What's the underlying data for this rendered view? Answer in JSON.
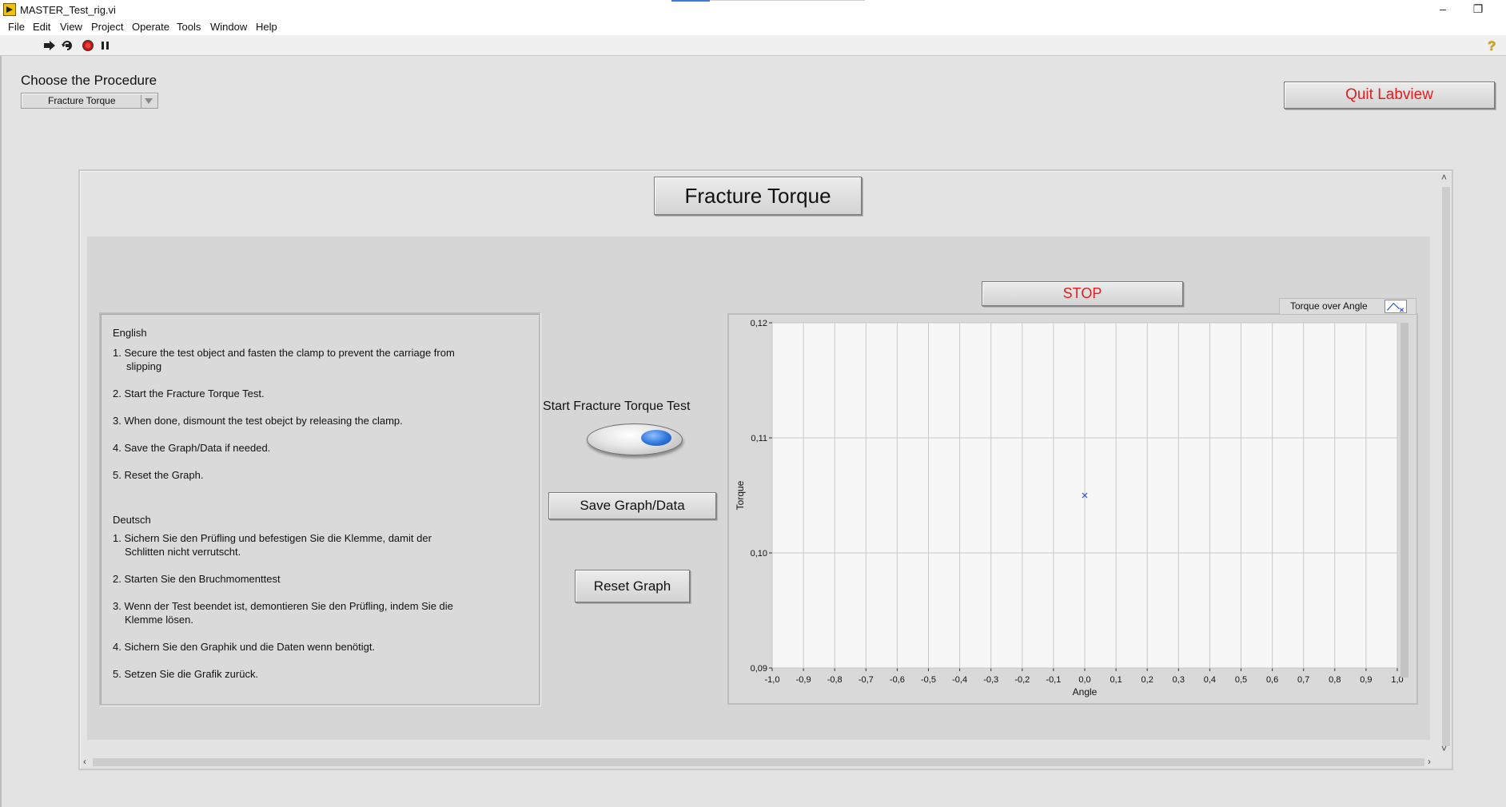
{
  "window": {
    "title": "MASTER_Test_rig.vi",
    "minimize": "–",
    "restore": "❐"
  },
  "menu": [
    "File",
    "Edit",
    "View",
    "Project",
    "Operate",
    "Tools",
    "Window",
    "Help"
  ],
  "toolbar": {
    "icons": [
      "run-arrow-icon",
      "run-continuously-icon",
      "abort-icon",
      "pause-icon"
    ],
    "help": "?"
  },
  "procedure": {
    "label": "Choose the Procedure",
    "selected": "Fracture Torque"
  },
  "quit_button": "Quit Labview",
  "tab": {
    "title": "Fracture Torque"
  },
  "instructions": {
    "english_heading": "English",
    "english": [
      "1. Secure the test object and fasten the clamp to prevent the carriage from",
      "slipping",
      "2. Start the Fracture Torque Test.",
      "3. When done, dismount the test obejct by releasing the clamp.",
      "4. Save the Graph/Data if needed.",
      "5. Reset the Graph."
    ],
    "deutsch_heading": "Deutsch",
    "deutsch": [
      "1. Sichern Sie den Prüfling und befestigen Sie die Klemme, damit der",
      "Schlitten nicht verrutscht.",
      "2. Starten Sie den Bruchmomenttest",
      "3. Wenn der Test beendet ist, demontieren Sie den Prüfling, indem Sie die",
      "Klemme lösen.",
      "4. Sichern Sie den Graphik und die Daten wenn benötigt.",
      "5. Setzen Sie die Grafik zurück."
    ]
  },
  "controls": {
    "start_label": "Start Fracture Torque Test",
    "start_state": false,
    "save_button": "Save Graph/Data",
    "reset_button": "Reset Graph",
    "stop_button": "STOP"
  },
  "colors": {
    "quit_text": "#e02020",
    "stop_text": "#e02020",
    "plot_point": "#2b4fd0",
    "toggle_knob": "#2e76dc"
  },
  "chart_data": {
    "type": "scatter",
    "legend": "Torque over Angle",
    "xlabel": "Angle",
    "ylabel": "Torque",
    "xlim": [
      -1.0,
      1.0
    ],
    "ylim": [
      0.09,
      0.12
    ],
    "xticks": [
      "-1,0",
      "-0,9",
      "-0,8",
      "-0,7",
      "-0,6",
      "-0,5",
      "-0,4",
      "-0,3",
      "-0,2",
      "-0,1",
      "0,0",
      "0,1",
      "0,2",
      "0,3",
      "0,4",
      "0,5",
      "0,6",
      "0,7",
      "0,8",
      "0,9",
      "1,0"
    ],
    "xtick_values": [
      -1.0,
      -0.9,
      -0.8,
      -0.7,
      -0.6,
      -0.5,
      -0.4,
      -0.3,
      -0.2,
      -0.1,
      0.0,
      0.1,
      0.2,
      0.3,
      0.4,
      0.5,
      0.6,
      0.7,
      0.8,
      0.9,
      1.0
    ],
    "yticks": [
      "0,09",
      "0,10",
      "0,11",
      "0,12"
    ],
    "ytick_values": [
      0.09,
      0.1,
      0.11,
      0.12
    ],
    "grid": true,
    "series": [
      {
        "x": [
          0.0
        ],
        "y": [
          0.105
        ]
      }
    ]
  }
}
